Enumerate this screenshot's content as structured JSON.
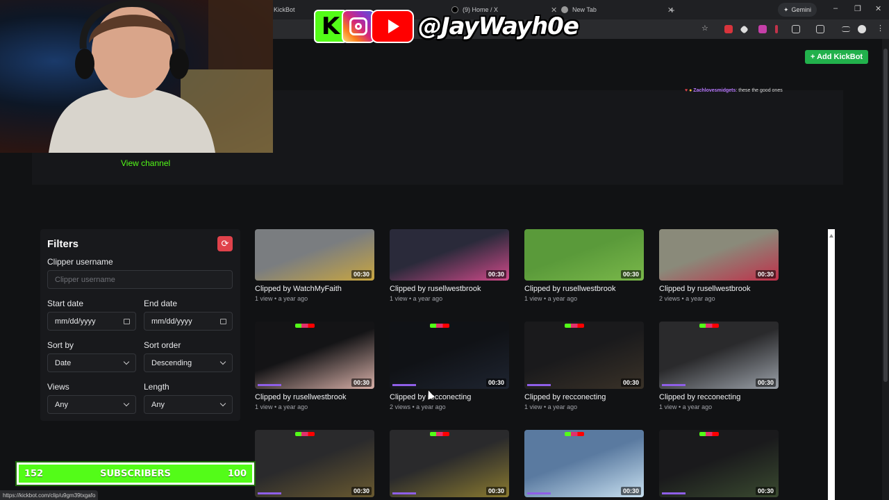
{
  "browser": {
    "tabs": [
      {
        "title": "KickBot"
      },
      {
        "title": "(9) Home / X"
      },
      {
        "title": "New Tab"
      }
    ],
    "gemini_label": "Gemini",
    "new_tab_symbol": "+"
  },
  "header": {
    "add_kickbot_label": "+ Add KickBot"
  },
  "chat": {
    "username": "Zachlovesmidgets",
    "message": ": these the good ones"
  },
  "player": {
    "view_channel_label": "View channel"
  },
  "filters": {
    "title": "Filters",
    "clipper_username_label": "Clipper username",
    "clipper_username_placeholder": "Clipper username",
    "start_date_label": "Start date",
    "start_date_value": "mm/dd/yyyy",
    "end_date_label": "End date",
    "end_date_value": "mm/dd/yyyy",
    "sort_by_label": "Sort by",
    "sort_by_value": "Date",
    "sort_order_label": "Sort order",
    "sort_order_value": "Descending",
    "views_label": "Views",
    "views_value": "Any",
    "length_label": "Length",
    "length_value": "Any"
  },
  "clips": [
    {
      "title": "Clipped by WatchMyFaith",
      "meta": "1 view • a year ago",
      "duration": "00:30",
      "colors": [
        "#7a7d80",
        "#c9a640"
      ]
    },
    {
      "title": "Clipped by rusellwestbrook",
      "meta": "1 view • a year ago",
      "duration": "00:30",
      "colors": [
        "#2a2a3a",
        "#d04a8a"
      ]
    },
    {
      "title": "Clipped by rusellwestbrook",
      "meta": "1 view • a year ago",
      "duration": "00:30",
      "colors": [
        "#5a9a3a",
        "#7ab84a"
      ]
    },
    {
      "title": "Clipped by rusellwestbrook",
      "meta": "2 views • a year ago",
      "duration": "00:30",
      "colors": [
        "#8a8a7a",
        "#c0304a"
      ]
    },
    {
      "title": "Clipped by rusellwestbrook",
      "meta": "1 view • a year ago",
      "duration": "00:30",
      "colors": [
        "#141416",
        "#d8b0a8"
      ]
    },
    {
      "title": "Clipped by recconecting",
      "meta": "2 views • a year ago",
      "duration": "00:30",
      "colors": [
        "#101216",
        "#1e2430"
      ]
    },
    {
      "title": "Clipped by recconecting",
      "meta": "1 view • a year ago",
      "duration": "00:30",
      "colors": [
        "#1a1a1c",
        "#3a3228"
      ]
    },
    {
      "title": "Clipped by recconecting",
      "meta": "1 view • a year ago",
      "duration": "00:30",
      "colors": [
        "#2a2a2c",
        "#9aa0a8"
      ]
    },
    {
      "title": "",
      "meta": "",
      "duration": "00:30",
      "colors": [
        "#2a2a2c",
        "#6a5a30"
      ]
    },
    {
      "title": "",
      "meta": "",
      "duration": "00:30",
      "colors": [
        "#2a2a2c",
        "#8a7a30"
      ]
    },
    {
      "title": "",
      "meta": "",
      "duration": "00:30",
      "colors": [
        "#5a7aa0",
        "#c8e0f0"
      ]
    },
    {
      "title": "",
      "meta": "",
      "duration": "00:30",
      "colors": [
        "#1a1a1c",
        "#3a4a30"
      ]
    }
  ],
  "overlay": {
    "kick_letter": "K",
    "social_handle": "@JayWayh0e",
    "sub_current": "152",
    "sub_label": "SUBSCRIBERS",
    "sub_goal": "100"
  },
  "status_url": "https://kickbot.com/clip/u9gm39txgafo",
  "colors": {
    "accent": "#53fc18",
    "button_green": "#22b14c",
    "reset_red": "#e0424b"
  }
}
